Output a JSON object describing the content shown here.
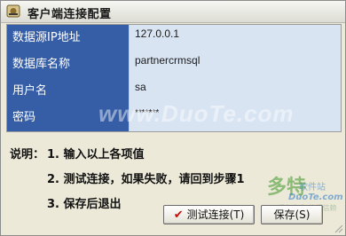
{
  "window": {
    "title": "客户端连接配置"
  },
  "fields": [
    {
      "label": "数据源IP地址",
      "value": "127.0.0.1"
    },
    {
      "label": "数据库名称",
      "value": "partnercrmsql"
    },
    {
      "label": "用户名",
      "value": "sa"
    },
    {
      "label": "密码",
      "value": "*******"
    }
  ],
  "notes": {
    "prefix": "说明：",
    "step1": "1.  输入以上各项值",
    "step2": "2.  测试连接，如果失败，请回到步骤1",
    "step3": "3.  保存后退出"
  },
  "buttons": {
    "test_label": "测试连接(T)",
    "save_label": "保存(S)"
  },
  "watermarks": {
    "center": "www.DuoTe.com",
    "logo_big": "多特",
    "logo_small": "软件站",
    "logo_url": "DuoTe.com",
    "logo_slogan": "绿色安全 值得信赖"
  },
  "colors": {
    "label_bg": "#365ea6",
    "value_bg": "#d9e4f3",
    "window_bg": "#ece9d8"
  },
  "icons": {
    "app": "db-connect-icon",
    "test_button": "checkmark-icon",
    "resize": "resize-grip-icon"
  }
}
